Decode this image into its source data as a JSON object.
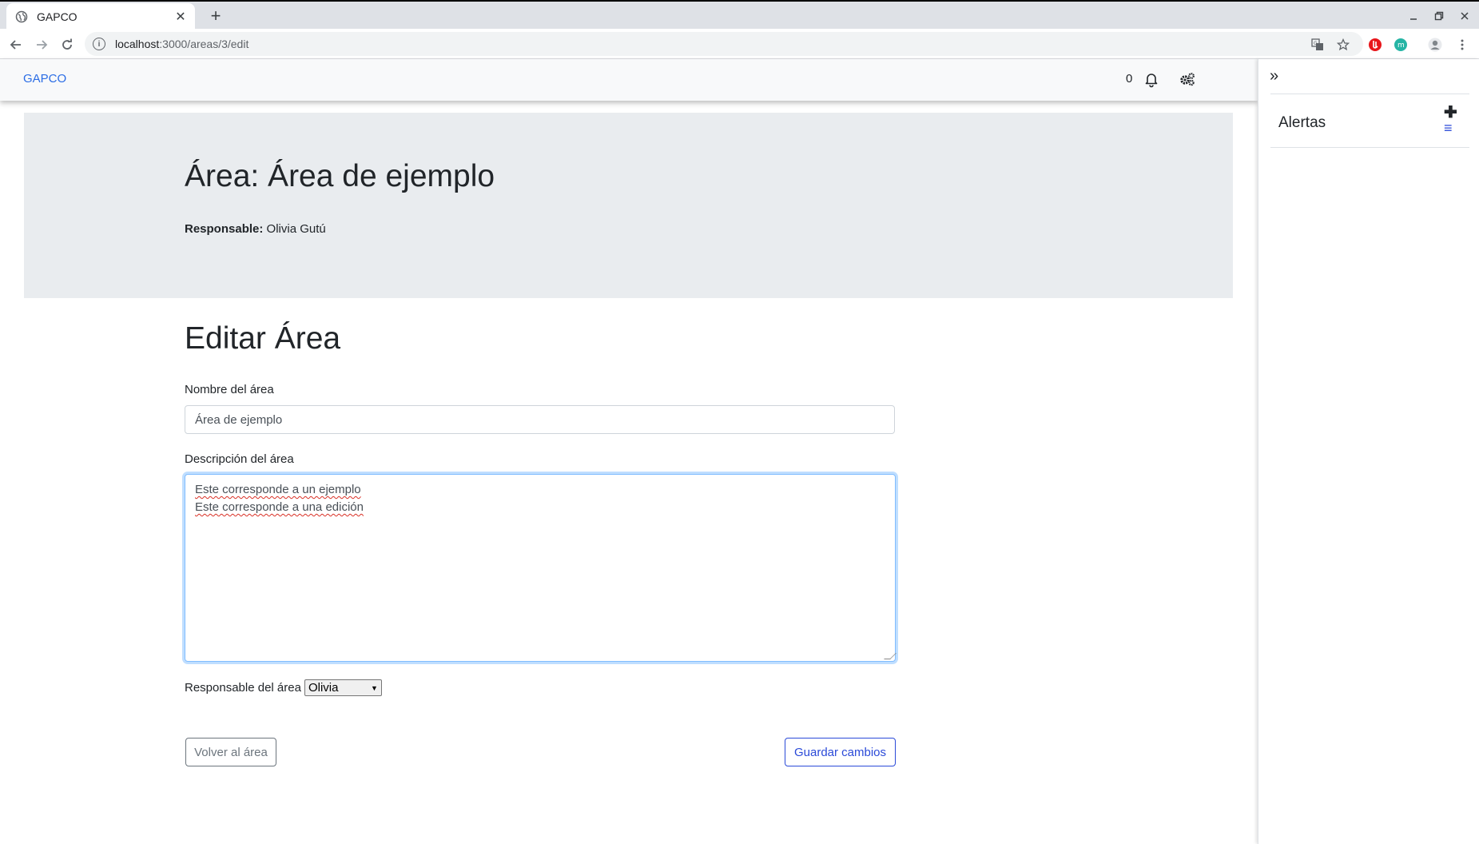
{
  "browser": {
    "tab_title": "GAPCO",
    "new_tab_glyph": "+",
    "url_host": "localhost",
    "url_path": ":3000/areas/3/edit"
  },
  "navbar": {
    "brand": "GAPCO",
    "notification_count": "0"
  },
  "hero": {
    "title": "Área: Área de ejemplo",
    "responsable_label": "Responsable:",
    "responsable_value": "Olivia Gutú"
  },
  "form": {
    "title": "Editar Área",
    "name_label": "Nombre del área",
    "name_value": "Área de ejemplo",
    "description_label": "Descripción del área",
    "description_lines": [
      "Este corresponde a un ejemplo",
      "Este corresponde a una edición"
    ],
    "owner_label": "Responsable del área",
    "owner_selected": "Olivia",
    "back_button": "Volver al área",
    "save_button": "Guardar cambios"
  },
  "sidebar": {
    "collapse_glyph": "»",
    "title": "Alertas",
    "add_glyph": "✚",
    "list_glyph": "≡"
  },
  "colors": {
    "brand": "#2b6de5",
    "primary": "#2b4ad8",
    "hero_bg": "#e9ecef"
  }
}
